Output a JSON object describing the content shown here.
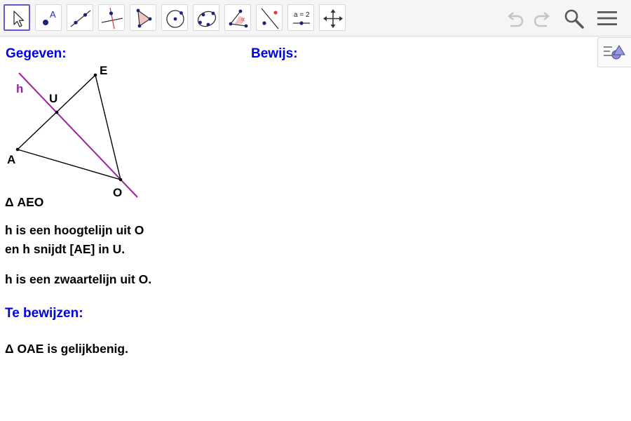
{
  "toolbar": {
    "tools": [
      {
        "name": "move-tool",
        "icon": "arrow-cursor-icon",
        "active": true
      },
      {
        "name": "point-tool",
        "icon": "point-icon",
        "label_glyph": "A"
      },
      {
        "name": "line-tool",
        "icon": "line-through-points-icon"
      },
      {
        "name": "perpendicular-line-tool",
        "icon": "perpendicular-line-icon"
      },
      {
        "name": "polygon-tool",
        "icon": "polygon-icon"
      },
      {
        "name": "circle-tool",
        "icon": "circle-center-point-icon"
      },
      {
        "name": "conic-tool",
        "icon": "conic-through-points-icon"
      },
      {
        "name": "angle-tool",
        "icon": "angle-icon",
        "label_glyph": "α"
      },
      {
        "name": "reflect-tool",
        "icon": "reflect-about-line-icon"
      },
      {
        "name": "slider-tool",
        "icon": "slider-icon",
        "label_glyph": "a = 2"
      },
      {
        "name": "move-graphics-view-tool",
        "icon": "move-graphics-view-icon"
      }
    ],
    "right_icons": [
      "undo-icon",
      "redo-icon",
      "search-icon",
      "menu-icon"
    ],
    "accent_color": "#6557d2"
  },
  "algebra_toggle": {
    "icon": "algebra-view-icon"
  },
  "canvas": {
    "given_heading": "Gegeven:",
    "proof_heading": "Bewijs:",
    "triangle_text": "Δ AEO",
    "altitude_line1": "h is een hoogtelijn uit O",
    "altitude_line2": "en h snijdt [AE] in U.",
    "median_text": "h is een zwaartelijn uit O.",
    "to_prove_heading": "Te bewijzen:",
    "to_prove_text": "Δ OAE is gelijkbenig.",
    "heading_color": "#0000e6",
    "line_h_color": "#a020a0"
  },
  "figure": {
    "points": [
      {
        "name": "A",
        "label": "A"
      },
      {
        "name": "E",
        "label": "E"
      },
      {
        "name": "O",
        "label": "O"
      },
      {
        "name": "U",
        "label": "U"
      }
    ],
    "line_label": "h"
  }
}
